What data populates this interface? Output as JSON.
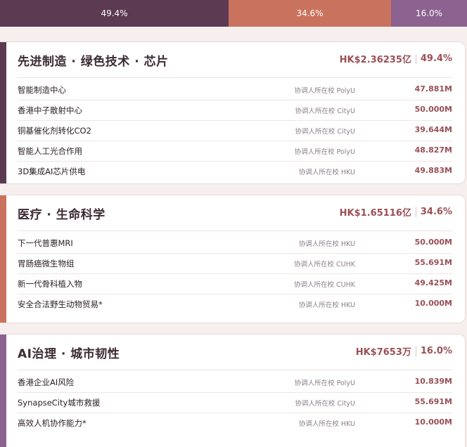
{
  "summary_bar": [
    {
      "label": "49.4%",
      "color": "#5b3a52"
    },
    {
      "label": "34.6%",
      "color": "#c9735e"
    },
    {
      "label": "16.0%",
      "color": "#8c6290"
    }
  ],
  "sections": [
    {
      "title": "先进制造 · 绿色技术 · 芯片",
      "amount": "HK$2.36235亿",
      "percent": "49.4%",
      "color": "#5b3a52",
      "rows": [
        {
          "name": "智能制造中心",
          "school": "协调人所在校 PolyU",
          "amount": "47.881M"
        },
        {
          "name": "香港中子散射中心",
          "school": "协调人所在校 CityU",
          "amount": "50.000M"
        },
        {
          "name": "铜基催化剂转化CO2",
          "school": "协调人所在校 CityU",
          "amount": "39.644M"
        },
        {
          "name": "智能人工光合作用",
          "school": "协调人所在校 PolyU",
          "amount": "48.827M"
        },
        {
          "name": "3D集成AI芯片供电",
          "school": "协调人所在校 HKU",
          "amount": "49.883M"
        }
      ]
    },
    {
      "title": "医疗 · 生命科学",
      "amount": "HK$1.65116亿",
      "percent": "34.6%",
      "color": "#c9735e",
      "rows": [
        {
          "name": "下一代普惠MRI",
          "school": "协调人所在校 HKU",
          "amount": "50.000M"
        },
        {
          "name": "胃肠癌微生物组",
          "school": "协调人所在校 CUHK",
          "amount": "55.691M"
        },
        {
          "name": "新一代骨科植入物",
          "school": "协调人所在校 CUHK",
          "amount": "49.425M"
        },
        {
          "name": "安全合法野生动物贸易*",
          "school": "协调人所在校 HKU",
          "amount": "10.000M"
        }
      ]
    },
    {
      "title": "AI治理 · 城市韧性",
      "amount": "HK$7653万",
      "percent": "16.0%",
      "color": "#8c6290",
      "rows": [
        {
          "name": "香港企业AI风险",
          "school": "协调人所在校 PolyU",
          "amount": "10.839M"
        },
        {
          "name": "SynapseCity城市救援",
          "school": "协调人所在校 CityU",
          "amount": "55.691M"
        },
        {
          "name": "高效人机协作能力*",
          "school": "协调人所在校 HKU",
          "amount": "10.000M"
        }
      ]
    }
  ]
}
